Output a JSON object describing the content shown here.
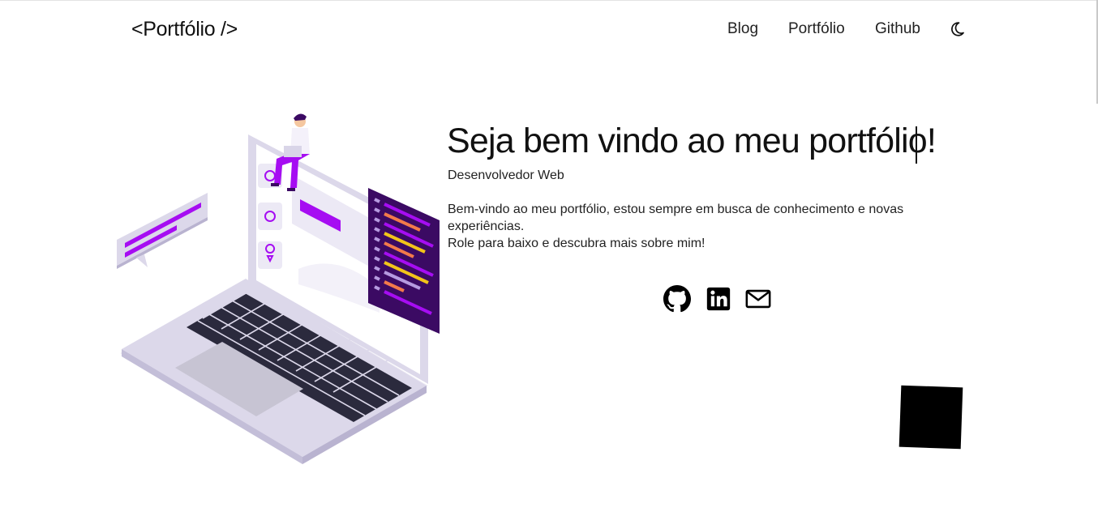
{
  "header": {
    "logo": "<Portfólio />",
    "nav": [
      {
        "label": "Blog"
      },
      {
        "label": "Portfólio"
      },
      {
        "label": "Github"
      }
    ],
    "theme_toggle_icon": "moon-icon"
  },
  "hero": {
    "title": "Seja bem vindo ao meu portfólio!",
    "subtitle": "Desenvolvedor Web",
    "intro_line1": "Bem-vindo ao meu portfólio, estou sempre em busca de conhecimento e novas experiências.",
    "intro_line2": "Role para baixo e descubra mais sobre mim!"
  },
  "social": [
    {
      "icon": "github-icon"
    },
    {
      "icon": "linkedin-icon"
    },
    {
      "icon": "mail-icon"
    }
  ],
  "colors": {
    "accent": "#a60df2",
    "dark_panel": "#3b0a63",
    "laptop_body": "#dcd8ea",
    "keys": "#2b2a3d"
  }
}
